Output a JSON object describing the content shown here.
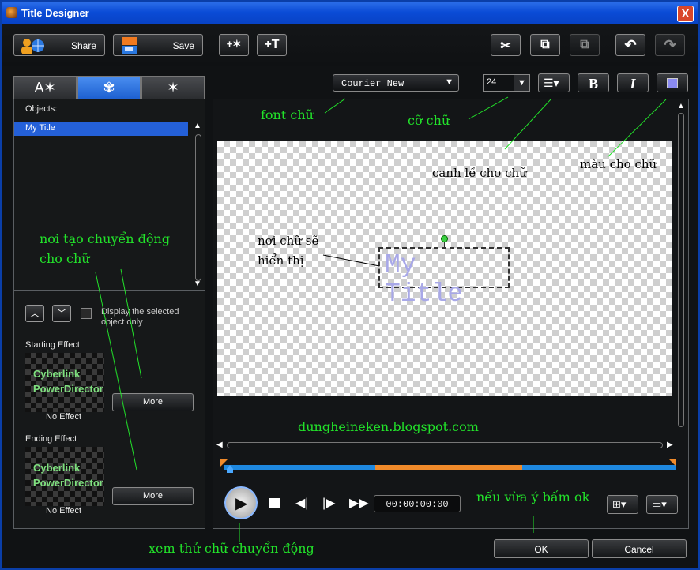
{
  "window": {
    "title": "Title Designer",
    "close_glyph": "X"
  },
  "toolbar": {
    "share_label": "Share",
    "save_label": "Save",
    "add_particle_glyph": "+✶",
    "add_text_glyph": "+T",
    "cut_glyph": "✂",
    "copy_glyph": "⧉",
    "paste_glyph": "⧉",
    "undo_glyph": "↶",
    "redo_glyph": "↷"
  },
  "tabs": [
    {
      "label": "A✶",
      "name": "text"
    },
    {
      "label": "✾",
      "name": "effects"
    },
    {
      "label": "✶",
      "name": "background"
    }
  ],
  "objects": {
    "header": "Objects:",
    "items": [
      "My Title"
    ]
  },
  "display_selected": {
    "label_line1": "Display the selected",
    "label_line2": "object only"
  },
  "starting_effect": {
    "label": "Starting Effect",
    "thumb_line1": "Cyberlink",
    "thumb_line2": "PowerDirector",
    "value": "No Effect",
    "more_label": "More"
  },
  "ending_effect": {
    "label": "Ending Effect",
    "thumb_line1": "Cyberlink",
    "thumb_line2": "PowerDirector",
    "value": "No Effect",
    "more_label": "More"
  },
  "format": {
    "font": "Courier New",
    "size": "24",
    "bold": "B",
    "italic": "I",
    "color": "#8a8af0"
  },
  "canvas": {
    "title_text": "My Title"
  },
  "playback": {
    "timecode": "00:00:00:00"
  },
  "footer": {
    "ok_label": "OK",
    "cancel_label": "Cancel"
  },
  "annotations": {
    "font": "font chữ",
    "size": "cỡ chữ",
    "align": "canh lề cho chữ",
    "color": "màu cho chữ",
    "motion_line1": "nơi tạo chuyển động",
    "motion_line2": "cho chữ",
    "display_line1": "nơi chữ sẽ",
    "display_line2": "hiển thị",
    "blog": "dungheineken.blogspot.com",
    "ok_hint": "nếu vừa ý bấm ok",
    "preview": "xem thử chữ chuyển động"
  },
  "colors": {
    "titlebar": "#0a4bd6",
    "accent_blue": "#1c5fd0",
    "timeline_orange": "#f08a2a",
    "annotation_green": "#22e22a"
  }
}
